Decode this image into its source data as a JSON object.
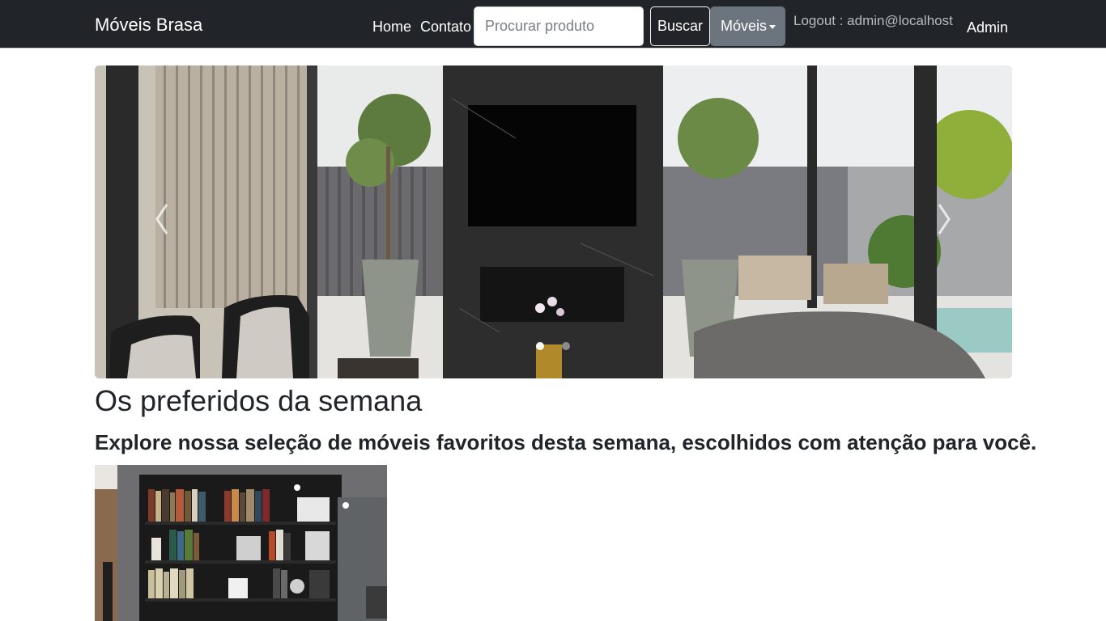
{
  "navbar": {
    "brand": "Móveis Brasa",
    "links": {
      "home": "Home",
      "contato": "Contato"
    },
    "search": {
      "placeholder": "Procurar produto",
      "value": ""
    },
    "search_button": "Buscar",
    "dropdown_label": "Móveis",
    "logout": "Logout : admin@localhost",
    "admin": "Admin"
  },
  "carousel": {
    "slide_count": 2,
    "active_slide": 1,
    "image": "living-room-with-fireplace-tv-and-garden-view"
  },
  "section": {
    "title": "Os preferidos da semana",
    "subtitle": "Explore nossa seleção de móveis favoritos desta semana, escolhidos com atenção para você."
  },
  "product": {
    "image": "bookshelf-library-room"
  },
  "colors": {
    "navbar_bg": "#212529",
    "dropdown_bg": "#6c757d",
    "text": "#212529"
  }
}
